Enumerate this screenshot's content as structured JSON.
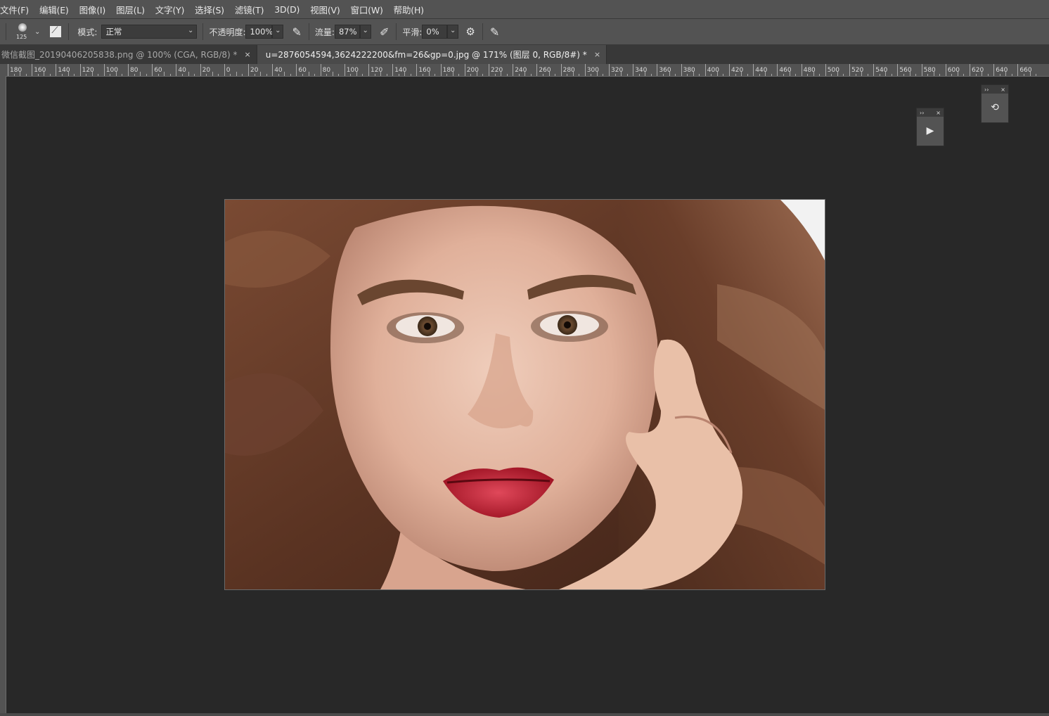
{
  "menu": [
    "文件(F)",
    "编辑(E)",
    "图像(I)",
    "图层(L)",
    "文字(Y)",
    "选择(S)",
    "滤镜(T)",
    "3D(D)",
    "视图(V)",
    "窗口(W)",
    "帮助(H)"
  ],
  "options": {
    "brush_size": "125",
    "mode_label": "模式:",
    "mode_value": "正常",
    "opacity_label": "不透明度:",
    "opacity_value": "100%",
    "flow_label": "流量:",
    "flow_value": "87%",
    "smoothing_label": "平滑:",
    "smoothing_value": "0%"
  },
  "tabs": [
    {
      "title": "微信截图_20190406205838.png @ 100% (CGA, RGB/8) *",
      "close": "×"
    },
    {
      "title": "u=2876054594,3624222200&fm=26&gp=0.jpg @ 171% (图层 0, RGB/8#) *",
      "close": "×"
    }
  ],
  "ruler_labels": [
    "180",
    "160",
    "140",
    "120",
    "100",
    "80",
    "60",
    "40",
    "20",
    "0",
    "20",
    "40",
    "60",
    "80",
    "100",
    "120",
    "140",
    "160",
    "180",
    "200",
    "220",
    "240",
    "260",
    "280",
    "300",
    "320",
    "340",
    "360",
    "380",
    "400",
    "420",
    "440",
    "460",
    "480",
    "500",
    "520",
    "540",
    "560",
    "580",
    "600",
    "620",
    "640",
    "660"
  ],
  "icons": {
    "brush_preset": "brush-preset-icon",
    "brush_panel": "brush-panel-icon",
    "opacity_pressure": "pressure-icon",
    "airbrush": "airbrush-icon",
    "settings": "gear-icon",
    "symmetry": "symmetry-icon",
    "play": "play-icon",
    "history": "history-icon"
  },
  "panels": {
    "collapse": "››",
    "close": "×"
  }
}
